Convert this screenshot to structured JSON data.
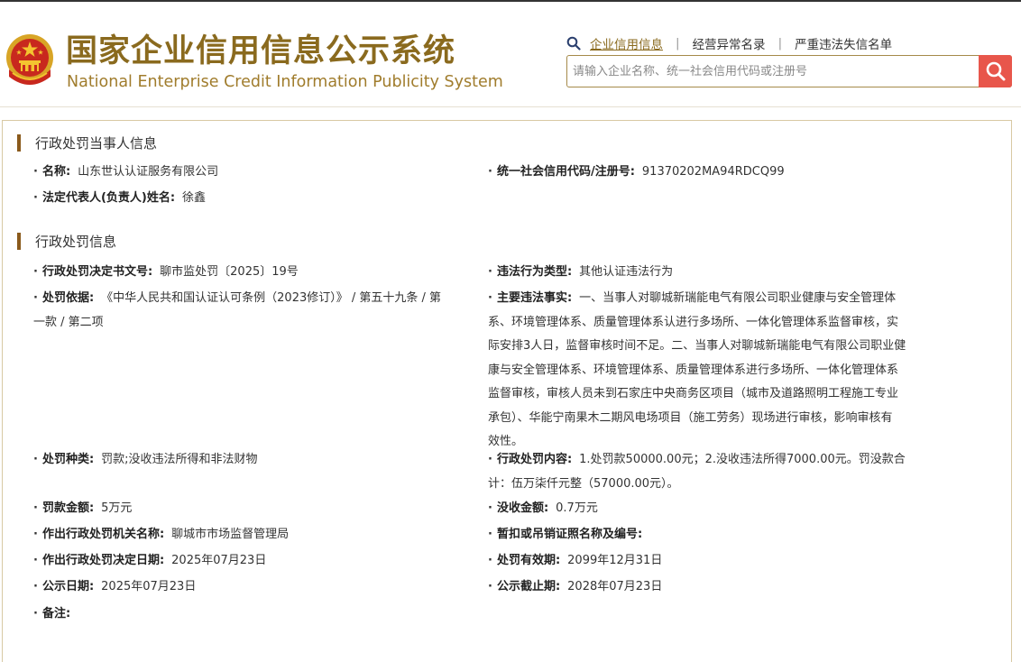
{
  "header": {
    "title_cn": "国家企业信用信息公示系统",
    "title_en": "National Enterprise Credit Information Publicity System",
    "nav": {
      "enterprise_info": "企业信用信息",
      "abnormal_list": "经营异常名录",
      "dishonest_list": "严重违法失信名单"
    },
    "search": {
      "placeholder": "请输入企业名称、统一社会信用代码或注册号"
    }
  },
  "party_section": {
    "title": "行政处罚当事人信息",
    "name_label": "名称:",
    "name_value": "山东世认认证服务有限公司",
    "credit_code_label": "统一社会信用代码/注册号:",
    "credit_code_value": "91370202MA94RDCQ99",
    "legal_rep_label": "法定代表人(负责人)姓名:",
    "legal_rep_value": "徐鑫"
  },
  "penalty_section": {
    "title": "行政处罚信息",
    "decision_no_label": "行政处罚决定书文号:",
    "decision_no_value": "聊市监处罚〔2025〕19号",
    "violation_type_label": "违法行为类型:",
    "violation_type_value": "其他认证违法行为",
    "basis_label": "处罚依据:",
    "basis_value_1": "《中华人民共和国认证认可条例（2023修订）》 / 第五十九条 / 第",
    "basis_value_2": "一款 / 第二项",
    "facts_label": "主要违法事实:",
    "facts_lines": [
      "一、当事人对聊城新瑞能电气有限公司职业健康与安全管理体",
      "系、环境管理体系、质量管理体系认进行多场所、一体化管理体系监督审核，实",
      "际安排3人日，监督审核时间不足。二、当事人对聊城新瑞能电气有限公司职业健",
      "康与安全管理体系、环境管理体系、质量管理体系进行多场所、一体化管理体系",
      "监督审核，审核人员未到石家庄中央商务区项目（城市及道路照明工程施工专业",
      "承包）、华能宁南果木二期风电场项目（施工劳务）现场进行审核，影响审核有",
      "效性。"
    ],
    "penalty_kind_label": "处罚种类:",
    "penalty_kind_value": "罚款;没收违法所得和非法财物",
    "content_label": "行政处罚内容:",
    "content_value_1": "1.处罚款50000.00元；2.没收违法所得7000.00元。罚没款合",
    "content_value_2": "计：伍万柒仟元整（57000.00元）。",
    "fine_label": "罚款金额:",
    "fine_value": "5万元",
    "confiscation_label": "没收金额:",
    "confiscation_value": "0.7万元",
    "authority_label": "作出行政处罚机关名称:",
    "authority_value": "聊城市市场监督管理局",
    "license_label": "暂扣或吊销证照名称及编号:",
    "license_value": "",
    "decision_date_label": "作出行政处罚决定日期:",
    "decision_date_value": "2025年07月23日",
    "validity_label": "处罚有效期:",
    "validity_value": "2099年12月31日",
    "publish_date_label": "公示日期:",
    "publish_date_value": "2025年07月23日",
    "publish_end_label": "公示截止期:",
    "publish_end_value": "2028年07月23日",
    "remarks_label": "备注:",
    "remarks_value": ""
  },
  "colors": {
    "brand_gold": "#8a6a1e",
    "section_bar": "#8a5a1c",
    "search_button": "#e8564b",
    "panel_border": "#d8c9a3"
  },
  "icons": {
    "emblem": "national-emblem-icon",
    "search_small": "search-icon",
    "search_button": "search-icon"
  }
}
